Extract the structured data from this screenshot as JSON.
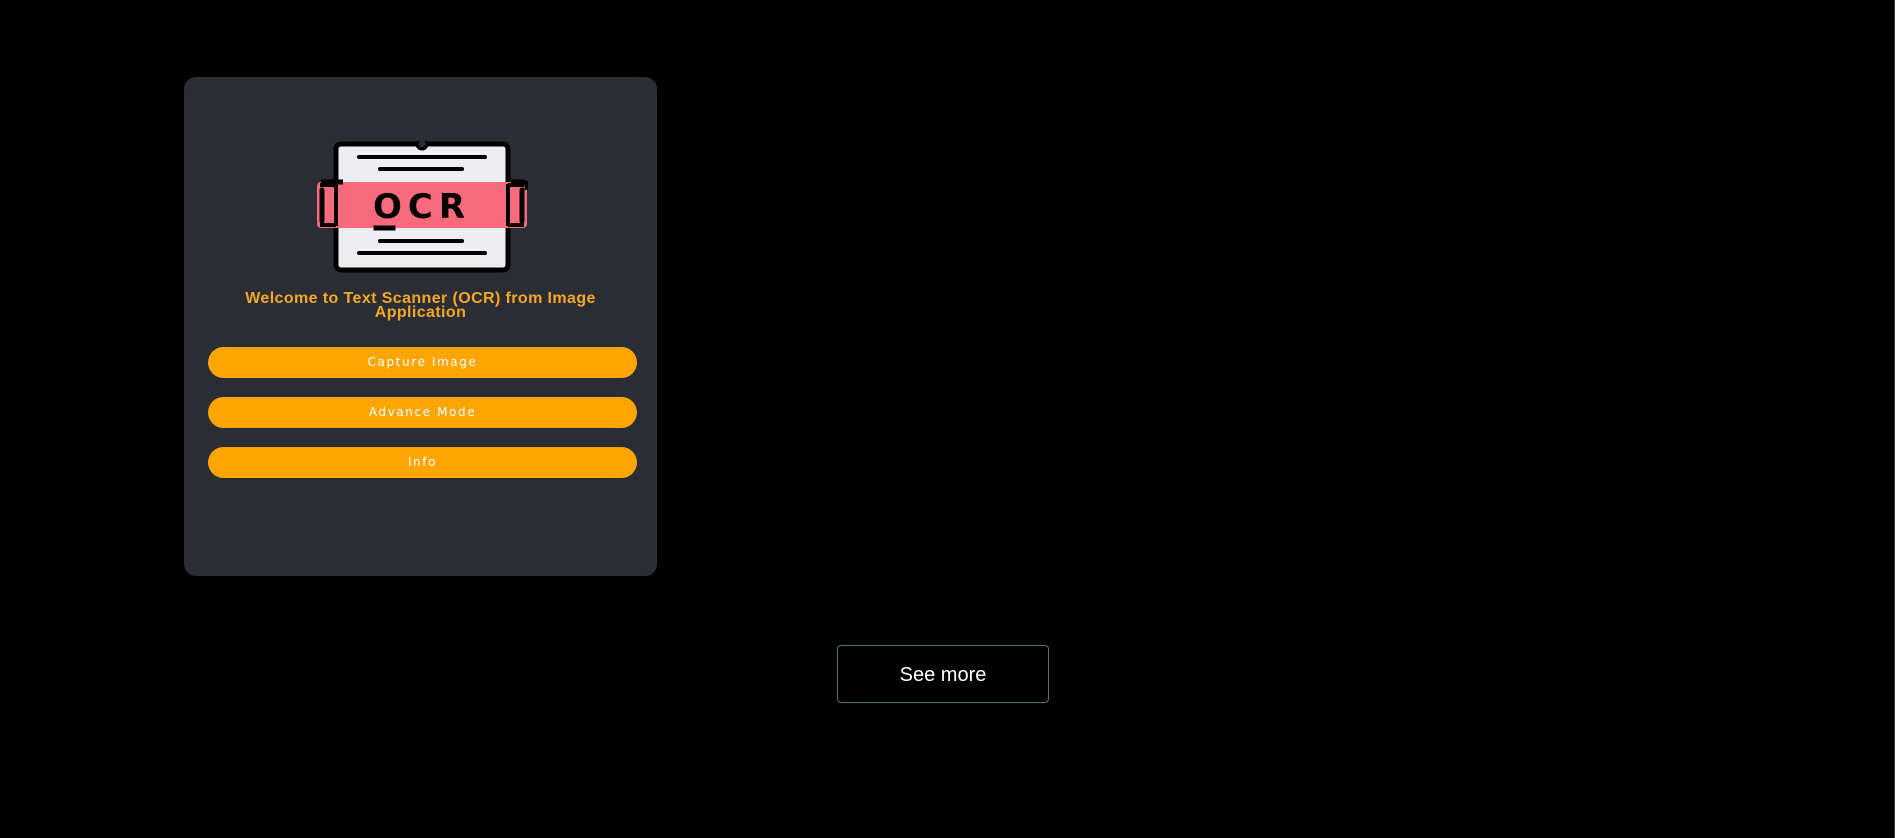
{
  "card": {
    "logo": {
      "icon": "ocr-document-icon",
      "text": "OCR"
    },
    "welcome_text": "Welcome to Text Scanner (OCR) from Image Application",
    "buttons": [
      {
        "label": "Capture Image"
      },
      {
        "label": "Advance Mode"
      },
      {
        "label": "Info"
      }
    ]
  },
  "see_more": {
    "label": "See more"
  },
  "colors": {
    "background": "#000000",
    "card": "#2b2d35",
    "accent": "#ffa500",
    "welcome_text": "#f5a623",
    "ocr_band": "#f96b7c",
    "see_more_border": "#4a7b6c"
  }
}
